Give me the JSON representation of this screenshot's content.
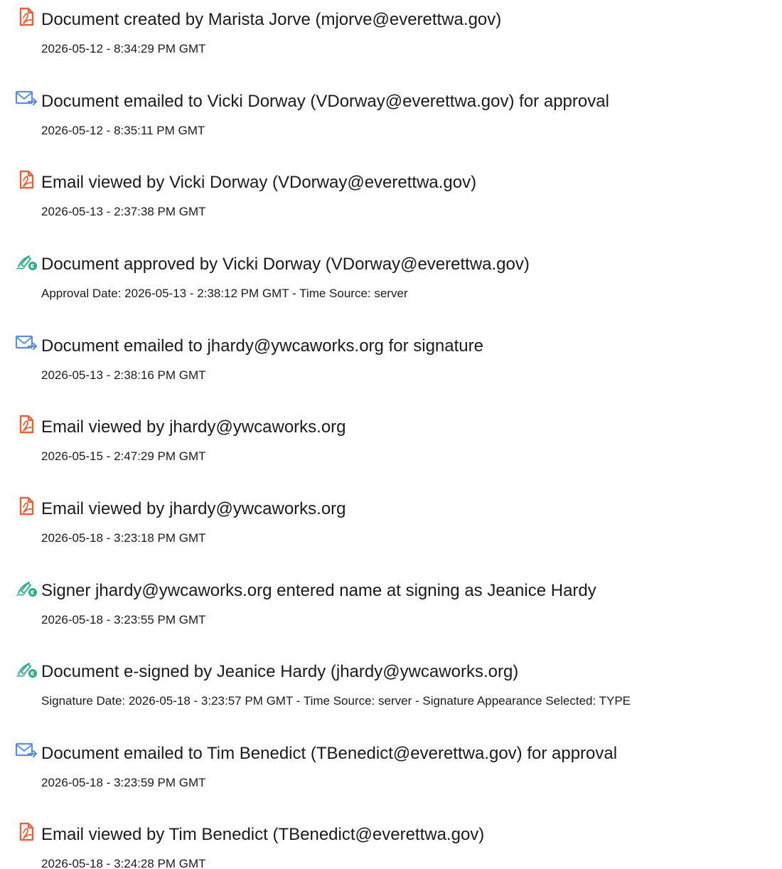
{
  "events": [
    {
      "icon": "document-icon",
      "title": "Document created by Marista Jorve (mjorve@everettwa.gov)",
      "detail": "2026-05-12 - 8:34:29 PM GMT"
    },
    {
      "icon": "email-sent-icon",
      "title": "Document emailed to Vicki Dorway (VDorway@everettwa.gov) for approval",
      "detail": "2026-05-12 - 8:35:11 PM GMT"
    },
    {
      "icon": "document-icon",
      "title": "Email viewed by Vicki Dorway (VDorway@everettwa.gov)",
      "detail": "2026-05-13 - 2:37:38 PM GMT"
    },
    {
      "icon": "signature-pen-icon",
      "title": "Document approved by Vicki Dorway (VDorway@everettwa.gov)",
      "detail": "Approval Date: 2026-05-13 - 2:38:12 PM GMT - Time Source: server"
    },
    {
      "icon": "email-sent-icon",
      "title": "Document emailed to jhardy@ywcaworks.org for signature",
      "detail": "2026-05-13 - 2:38:16 PM GMT"
    },
    {
      "icon": "document-icon",
      "title": "Email viewed by jhardy@ywcaworks.org",
      "detail": "2026-05-15 - 2:47:29 PM GMT"
    },
    {
      "icon": "document-icon",
      "title": "Email viewed by jhardy@ywcaworks.org",
      "detail": "2026-05-18 - 3:23:18 PM GMT"
    },
    {
      "icon": "signature-pen-icon",
      "title": "Signer jhardy@ywcaworks.org entered name at signing as Jeanice Hardy",
      "detail": "2026-05-18 - 3:23:55 PM GMT"
    },
    {
      "icon": "signature-pen-icon",
      "title": "Document e-signed by Jeanice Hardy (jhardy@ywcaworks.org)",
      "detail": "Signature Date: 2026-05-18 - 3:23:57 PM GMT - Time Source: server - Signature Appearance Selected: TYPE"
    },
    {
      "icon": "email-sent-icon",
      "title": "Document emailed to Tim Benedict (TBenedict@everettwa.gov) for approval",
      "detail": "2026-05-18 - 3:23:59 PM GMT"
    },
    {
      "icon": "document-icon",
      "title": "Email viewed by Tim Benedict (TBenedict@everettwa.gov)",
      "detail": "2026-05-18 - 3:24:28 PM GMT"
    }
  ],
  "colors": {
    "document_icon": "#e8613a",
    "email_icon": "#5a8fd6",
    "signature_icon": "#2bab8a"
  }
}
